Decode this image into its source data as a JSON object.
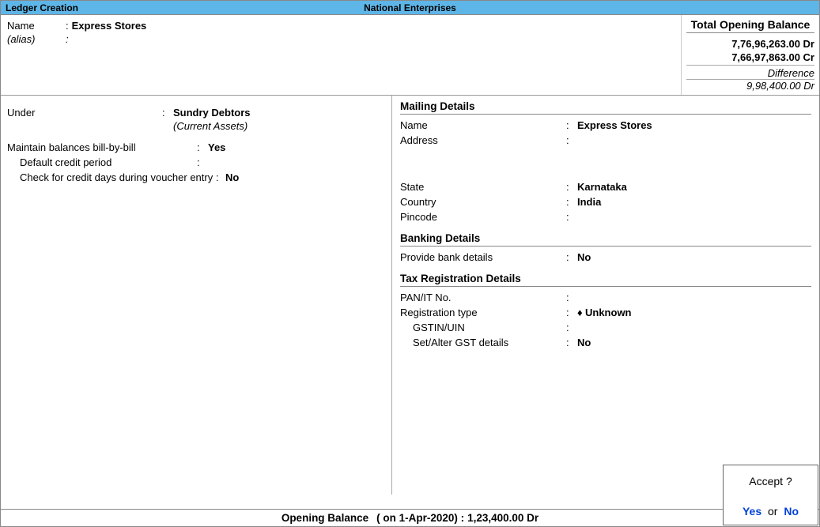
{
  "titlebar": {
    "left": "Ledger Creation",
    "center": "National Enterprises"
  },
  "name_section": {
    "name_label": "Name",
    "name_value": "Express Stores",
    "alias_label": "(alias)",
    "alias_value": ""
  },
  "balance_box": {
    "header": "Total Opening Balance",
    "dr": "7,76,96,263.00 Dr",
    "cr": "7,66,97,863.00 Cr",
    "diff_label": "Difference",
    "diff_value": "9,98,400.00 Dr"
  },
  "left_panel": {
    "under_label": "Under",
    "under_value": "Sundry Debtors",
    "under_sub": "(Current Assets)",
    "maintain_label": "Maintain balances bill-by-bill",
    "maintain_value": "Yes",
    "credit_period_label": "Default credit period",
    "credit_period_value": "",
    "check_credit_label": "Check for credit days during voucher entry",
    "check_credit_value": "No"
  },
  "mailing": {
    "header": "Mailing Details",
    "name_label": "Name",
    "name_value": "Express Stores",
    "address_label": "Address",
    "address_value": "",
    "state_label": "State",
    "state_value": "Karnataka",
    "country_label": "Country",
    "country_value": "India",
    "pincode_label": "Pincode",
    "pincode_value": ""
  },
  "banking": {
    "header": "Banking Details",
    "provide_label": "Provide bank details",
    "provide_value": "No"
  },
  "tax": {
    "header": "Tax Registration Details",
    "pan_label": "PAN/IT No.",
    "pan_value": "",
    "regtype_label": "Registration type",
    "regtype_value": "Unknown",
    "gstin_label": "GSTIN/UIN",
    "gstin_value": "",
    "setalter_label": "Set/Alter GST details",
    "setalter_value": "No"
  },
  "footer": {
    "label": "Opening Balance",
    "date_prefix": "( on 1-Apr-2020)  :",
    "amount": "1,23,400.00  Dr"
  },
  "accept": {
    "question": "Accept ?",
    "yes": "Yes",
    "or": "or",
    "no": "No"
  }
}
